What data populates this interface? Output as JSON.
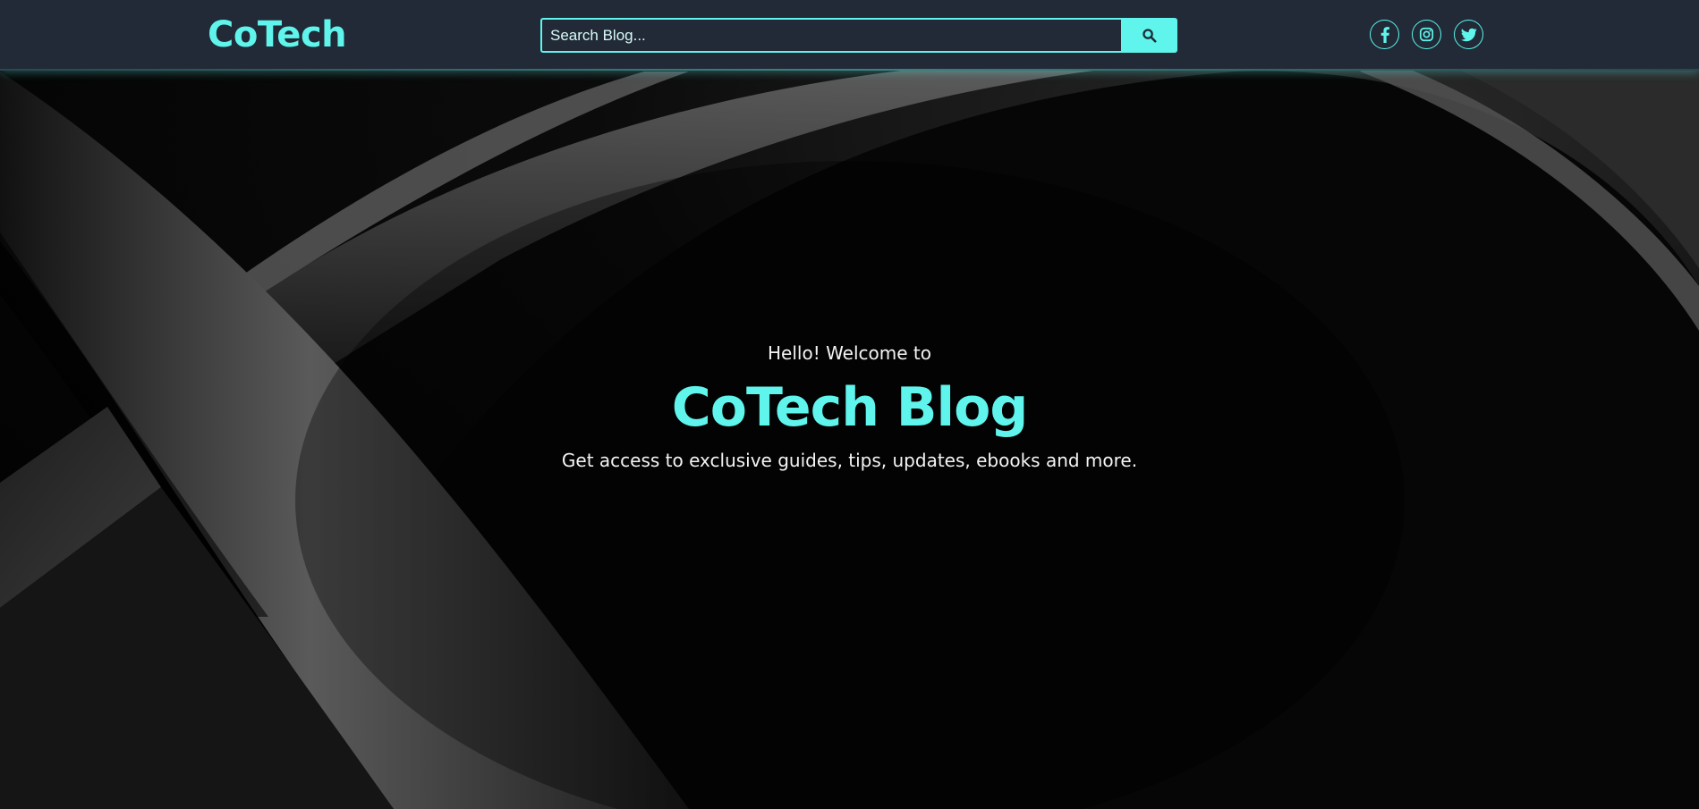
{
  "header": {
    "logo": "CoTech",
    "search": {
      "placeholder": "Search Blog...",
      "value": "",
      "button_icon": "search-icon"
    },
    "social": [
      {
        "name": "facebook",
        "icon": "facebook-icon"
      },
      {
        "name": "instagram",
        "icon": "instagram-icon"
      },
      {
        "name": "twitter",
        "icon": "twitter-icon"
      }
    ]
  },
  "hero": {
    "eyebrow": "Hello! Welcome to",
    "title": "CoTech Blog",
    "subtitle": "Get access to exclusive guides, tips, updates, ebooks and more."
  },
  "colors": {
    "accent": "#5ff5ec",
    "header_bg": "#212a36",
    "hero_bg": "#050505",
    "text_light": "#f4f4f4"
  }
}
